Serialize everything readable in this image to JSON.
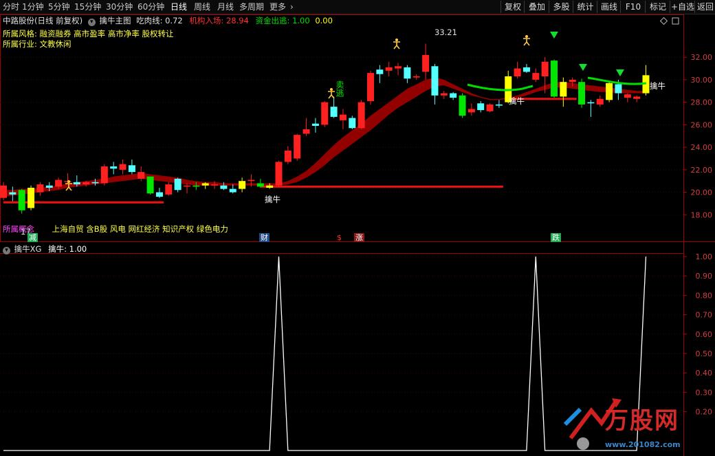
{
  "toolbar": {
    "period_tabs": [
      "分时",
      "1分钟",
      "5分钟",
      "15分钟",
      "30分钟",
      "60分钟",
      "日线",
      "周线",
      "月线",
      "多周期",
      "更多"
    ],
    "more_arrow": "›",
    "right_buttons": [
      "复权",
      "叠加",
      "多股",
      "统计",
      "画线",
      "F10",
      "标记",
      "+自选",
      "返回"
    ]
  },
  "main_header": {
    "stock": "中路股份(日线 前复权)",
    "indicator": "擒牛主图",
    "chirou_label": "吃肉线:",
    "chirou_value": "0.72",
    "jigou_label": "机构入场:",
    "jigou_value": "28.94",
    "zijin_label": "资金出逃:",
    "zijin_value": "1.00",
    "zijin_value2": "0.00"
  },
  "info": {
    "style_line": "所属风格: 融资融券 高市盈率 高市净率 股权转让",
    "industry_line": "所属行业: 文教休闲",
    "concept_prefix": "所属概念",
    "concept_line": "上海自贸 含B股 风电 网红经济 知识产权 绿色电力"
  },
  "annotations": {
    "peak_label": "33.21",
    "low_label": "17.",
    "qinniu": "擒牛",
    "maitao": "卖逃",
    "jian": "减",
    "cai": "财",
    "dollar": "$",
    "zhang": "涨",
    "die": "跌"
  },
  "sub_header": {
    "name": "擒牛XG",
    "label": "擒牛:",
    "value": "1.00"
  },
  "watermark": {
    "brand": "万股网",
    "url": "www.201082.com"
  },
  "colors": {
    "up": "#ff2020",
    "down": "#54ffff",
    "yellow": "#ffff00",
    "green": "#00e600",
    "ribbon": "#9a0000",
    "axis": "#c00000"
  },
  "chart_data": {
    "type": "candlestick",
    "price_axis": {
      "ticks": [
        "32.00",
        "30.00",
        "28.00",
        "26.00",
        "24.00",
        "22.00",
        "20.00",
        "18.00"
      ],
      "range": [
        17.1,
        33.6
      ]
    },
    "candles": [
      {
        "o": 19.5,
        "h": 20.9,
        "l": 19.3,
        "c": 20.6,
        "k": "up"
      },
      {
        "o": 19.8,
        "h": 20.5,
        "l": 19.2,
        "c": 20.0,
        "k": "down"
      },
      {
        "o": 18.4,
        "h": 20.3,
        "l": 18.1,
        "c": 20.2,
        "k": "green"
      },
      {
        "o": 18.6,
        "h": 20.6,
        "l": 18.4,
        "c": 20.4,
        "k": "yellow"
      },
      {
        "o": 20.0,
        "h": 20.9,
        "l": 19.7,
        "c": 20.7,
        "k": "up"
      },
      {
        "o": 20.4,
        "h": 20.9,
        "l": 20.1,
        "c": 20.6,
        "k": "down"
      },
      {
        "o": 20.5,
        "h": 21.3,
        "l": 20.3,
        "c": 21.1,
        "k": "up"
      },
      {
        "o": 21.0,
        "h": 21.7,
        "l": 20.8,
        "c": 21.0,
        "k": "up"
      },
      {
        "o": 20.9,
        "h": 21.5,
        "l": 20.5,
        "c": 20.7,
        "k": "down"
      },
      {
        "o": 20.7,
        "h": 21.0,
        "l": 20.5,
        "c": 20.9,
        "k": "up"
      },
      {
        "o": 20.9,
        "h": 21.2,
        "l": 20.6,
        "c": 20.8,
        "k": "down"
      },
      {
        "o": 20.8,
        "h": 22.5,
        "l": 20.6,
        "c": 22.3,
        "k": "up"
      },
      {
        "o": 22.3,
        "h": 22.7,
        "l": 21.6,
        "c": 22.1,
        "k": "down"
      },
      {
        "o": 22.0,
        "h": 22.9,
        "l": 21.6,
        "c": 22.5,
        "k": "up"
      },
      {
        "o": 22.4,
        "h": 22.9,
        "l": 21.6,
        "c": 21.8,
        "k": "down"
      },
      {
        "o": 21.8,
        "h": 22.3,
        "l": 21.0,
        "c": 21.2,
        "k": "up"
      },
      {
        "o": 21.4,
        "h": 21.4,
        "l": 19.8,
        "c": 19.9,
        "k": "green"
      },
      {
        "o": 20.0,
        "h": 20.4,
        "l": 19.5,
        "c": 19.6,
        "k": "down"
      },
      {
        "o": 19.8,
        "h": 20.9,
        "l": 19.7,
        "c": 20.7,
        "k": "up"
      },
      {
        "o": 20.2,
        "h": 21.3,
        "l": 20.0,
        "c": 21.2,
        "k": "down"
      },
      {
        "o": 20.5,
        "h": 20.8,
        "l": 19.9,
        "c": 20.6,
        "k": "up"
      },
      {
        "o": 20.5,
        "h": 20.9,
        "l": 20.2,
        "c": 20.6,
        "k": "green"
      },
      {
        "o": 20.6,
        "h": 20.9,
        "l": 20.3,
        "c": 20.8,
        "k": "yellow"
      },
      {
        "o": 20.6,
        "h": 21.0,
        "l": 20.3,
        "c": 20.7,
        "k": "up"
      },
      {
        "o": 20.6,
        "h": 20.9,
        "l": 20.2,
        "c": 20.3,
        "k": "down"
      },
      {
        "o": 20.0,
        "h": 20.7,
        "l": 19.9,
        "c": 20.3,
        "k": "down"
      },
      {
        "o": 20.3,
        "h": 21.3,
        "l": 20.0,
        "c": 21.0,
        "k": "yellow"
      },
      {
        "o": 21.0,
        "h": 21.6,
        "l": 20.5,
        "c": 21.1,
        "k": "up"
      },
      {
        "o": 20.8,
        "h": 21.2,
        "l": 20.4,
        "c": 20.5,
        "k": "green"
      },
      {
        "o": 20.6,
        "h": 20.8,
        "l": 20.3,
        "c": 20.4,
        "k": "yellow"
      },
      {
        "o": 20.6,
        "h": 22.8,
        "l": 20.5,
        "c": 22.7,
        "k": "up"
      },
      {
        "o": 22.7,
        "h": 24.1,
        "l": 22.5,
        "c": 23.7,
        "k": "up"
      },
      {
        "o": 23.0,
        "h": 25.2,
        "l": 22.8,
        "c": 25.1,
        "k": "up"
      },
      {
        "o": 25.2,
        "h": 26.6,
        "l": 25.0,
        "c": 25.6,
        "k": "up"
      },
      {
        "o": 25.9,
        "h": 26.6,
        "l": 25.3,
        "c": 26.1,
        "k": "down"
      },
      {
        "o": 26.0,
        "h": 28.1,
        "l": 25.8,
        "c": 28.0,
        "k": "up"
      },
      {
        "o": 27.6,
        "h": 28.5,
        "l": 26.6,
        "c": 26.7,
        "k": "down"
      },
      {
        "o": 26.9,
        "h": 27.4,
        "l": 25.6,
        "c": 26.4,
        "k": "up"
      },
      {
        "o": 25.7,
        "h": 26.8,
        "l": 25.6,
        "c": 26.6,
        "k": "down"
      },
      {
        "o": 25.7,
        "h": 28.2,
        "l": 25.6,
        "c": 28.0,
        "k": "up"
      },
      {
        "o": 28.1,
        "h": 30.8,
        "l": 27.8,
        "c": 30.6,
        "k": "up"
      },
      {
        "o": 30.5,
        "h": 31.3,
        "l": 29.7,
        "c": 30.9,
        "k": "down"
      },
      {
        "o": 30.8,
        "h": 31.6,
        "l": 30.3,
        "c": 31.1,
        "k": "up"
      },
      {
        "o": 31.0,
        "h": 31.5,
        "l": 30.4,
        "c": 31.2,
        "k": "up"
      },
      {
        "o": 30.1,
        "h": 31.3,
        "l": 29.7,
        "c": 31.1,
        "k": "down"
      },
      {
        "o": 30.3,
        "h": 30.5,
        "l": 30.0,
        "c": 30.2,
        "k": "up"
      },
      {
        "o": 30.7,
        "h": 33.2,
        "l": 30.0,
        "c": 32.2,
        "k": "up"
      },
      {
        "o": 31.2,
        "h": 31.4,
        "l": 27.8,
        "c": 28.6,
        "k": "down"
      },
      {
        "o": 28.8,
        "h": 29.0,
        "l": 28.3,
        "c": 28.6,
        "k": "up"
      },
      {
        "o": 28.8,
        "h": 28.9,
        "l": 28.2,
        "c": 28.4,
        "k": "down"
      },
      {
        "o": 28.6,
        "h": 28.8,
        "l": 26.6,
        "c": 26.8,
        "k": "green"
      },
      {
        "o": 27.4,
        "h": 27.9,
        "l": 26.8,
        "c": 27.1,
        "k": "up"
      },
      {
        "o": 27.3,
        "h": 28.1,
        "l": 27.1,
        "c": 27.9,
        "k": "down"
      },
      {
        "o": 27.8,
        "h": 27.9,
        "l": 27.1,
        "c": 27.2,
        "k": "up"
      },
      {
        "o": 27.7,
        "h": 28.2,
        "l": 27.5,
        "c": 27.8,
        "k": "down"
      },
      {
        "o": 28.0,
        "h": 30.8,
        "l": 27.9,
        "c": 30.3,
        "k": "yellow"
      },
      {
        "o": 30.3,
        "h": 31.6,
        "l": 30.1,
        "c": 31.0,
        "k": "up"
      },
      {
        "o": 31.1,
        "h": 31.4,
        "l": 30.6,
        "c": 30.7,
        "k": "down"
      },
      {
        "o": 30.6,
        "h": 31.0,
        "l": 29.8,
        "c": 30.0,
        "k": "up"
      },
      {
        "o": 30.3,
        "h": 32.0,
        "l": 28.8,
        "c": 31.6,
        "k": "up"
      },
      {
        "o": 31.7,
        "h": 31.8,
        "l": 28.4,
        "c": 28.5,
        "k": "green"
      },
      {
        "o": 28.5,
        "h": 30.2,
        "l": 27.6,
        "c": 29.8,
        "k": "yellow"
      },
      {
        "o": 29.8,
        "h": 30.2,
        "l": 29.4,
        "c": 30.0,
        "k": "up"
      },
      {
        "o": 29.8,
        "h": 30.1,
        "l": 27.5,
        "c": 27.8,
        "k": "green"
      },
      {
        "o": 27.9,
        "h": 28.2,
        "l": 26.7,
        "c": 28.0,
        "k": "down"
      },
      {
        "o": 27.8,
        "h": 28.6,
        "l": 27.6,
        "c": 28.3,
        "k": "up"
      },
      {
        "o": 28.2,
        "h": 29.9,
        "l": 28.0,
        "c": 29.7,
        "k": "yellow"
      },
      {
        "o": 28.8,
        "h": 30.0,
        "l": 28.2,
        "c": 29.6,
        "k": "down"
      },
      {
        "o": 28.4,
        "h": 28.8,
        "l": 28.0,
        "c": 28.7,
        "k": "up"
      },
      {
        "o": 28.3,
        "h": 28.6,
        "l": 28.0,
        "c": 28.5,
        "k": "up"
      },
      {
        "o": 28.8,
        "h": 31.3,
        "l": 28.6,
        "c": 30.4,
        "k": "yellow"
      }
    ],
    "ribbon_upper": [
      20.2,
      20.2,
      20.3,
      20.3,
      20.4,
      20.5,
      20.6,
      20.8,
      20.9,
      21.0,
      21.1,
      21.2,
      21.4,
      21.5,
      21.6,
      21.7,
      21.6,
      21.5,
      21.4,
      21.3,
      21.1,
      21.0,
      20.9,
      20.9,
      20.8,
      20.8,
      20.8,
      20.8,
      20.8,
      20.8,
      20.8,
      21.0,
      21.4,
      21.9,
      22.6,
      23.4,
      24.2,
      24.9,
      25.5,
      26.1,
      26.8,
      27.4,
      28.0,
      28.6,
      29.2,
      29.6,
      30.0,
      30.2,
      30.0,
      29.6,
      29.2,
      28.8,
      28.5,
      28.3,
      28.3,
      28.4,
      28.6,
      28.9,
      29.2,
      29.5,
      29.8,
      29.8,
      29.7,
      29.6,
      29.5,
      29.4,
      29.3,
      29.2,
      29.1,
      29.0,
      29.0
    ],
    "ribbon_lower": [
      19.6,
      19.7,
      19.8,
      19.9,
      20.0,
      20.1,
      20.2,
      20.4,
      20.5,
      20.6,
      20.7,
      20.8,
      20.9,
      21.0,
      21.1,
      21.2,
      21.1,
      21.0,
      20.9,
      20.8,
      20.7,
      20.6,
      20.6,
      20.6,
      20.6,
      20.6,
      20.6,
      20.6,
      20.6,
      20.6,
      20.6,
      20.7,
      20.9,
      21.3,
      21.8,
      22.4,
      23.1,
      23.7,
      24.3,
      24.9,
      25.5,
      26.2,
      26.9,
      27.5,
      28.0,
      28.5,
      29.0,
      29.4,
      29.5,
      29.2,
      28.9,
      28.6,
      28.4,
      28.2,
      28.2,
      28.3,
      28.4,
      28.6,
      28.9,
      29.1,
      29.3,
      29.3,
      29.2,
      29.1,
      29.0,
      28.9,
      28.9,
      28.8,
      28.8,
      28.8,
      28.8
    ],
    "support_lines": [
      {
        "from": 0,
        "to": 17,
        "price": 19.1
      },
      {
        "from": 28,
        "to": 54,
        "price": 20.5
      },
      {
        "from": 55,
        "to": 62,
        "price": 28.3
      }
    ],
    "signal_axis": {
      "ticks": [
        "1.00",
        "0.90",
        "0.80",
        "0.70",
        "0.60",
        "0.50",
        "0.40",
        "0.30",
        "0.20"
      ],
      "range": [
        0,
        1
      ]
    },
    "signal_series": [
      0,
      0,
      0,
      0,
      0,
      0,
      0,
      0,
      0,
      0,
      0,
      0,
      0,
      0,
      0,
      0,
      0,
      0,
      0,
      0,
      0,
      0,
      0,
      0,
      0,
      0,
      0,
      0,
      0,
      0,
      1,
      0,
      0,
      0,
      0,
      0,
      0,
      0,
      0,
      0,
      0,
      0,
      0,
      0,
      0,
      0,
      0,
      0,
      0,
      0,
      0,
      0,
      0,
      0,
      0,
      0,
      0,
      0,
      1,
      0,
      0,
      0,
      0,
      0,
      0,
      0,
      0,
      0,
      0,
      0,
      1
    ]
  }
}
